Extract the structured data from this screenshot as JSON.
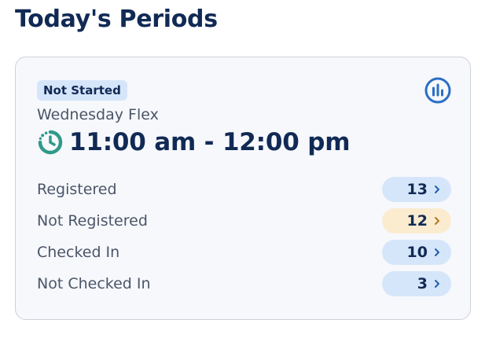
{
  "page": {
    "title": "Today's Periods"
  },
  "period_card": {
    "status_badge": "Not Started",
    "period_name": "Wednesday Flex",
    "time_range": "11:00 am - 12:00 pm",
    "stats_icon": "bar-chart-icon",
    "clock_icon": "clock-icon",
    "stats": [
      {
        "label": "Registered",
        "count": "13",
        "tone": "blue"
      },
      {
        "label": "Not Registered",
        "count": "12",
        "tone": "amber"
      },
      {
        "label": "Checked In",
        "count": "10",
        "tone": "blue"
      },
      {
        "label": "Not Checked In",
        "count": "3",
        "tone": "blue"
      }
    ]
  },
  "colors": {
    "title_text": "#112a55",
    "secondary_text": "#4a5568",
    "card_background": "#f7f8fc",
    "card_border": "#cdd1d8",
    "blue_pill": "#d6e6fa",
    "amber_pill": "#fbecd0",
    "blue_chevron": "#1f5fae",
    "amber_chevron": "#b8761e",
    "stats_icon": "#2a6fc4",
    "clock_icon": "#2f9a8a"
  }
}
